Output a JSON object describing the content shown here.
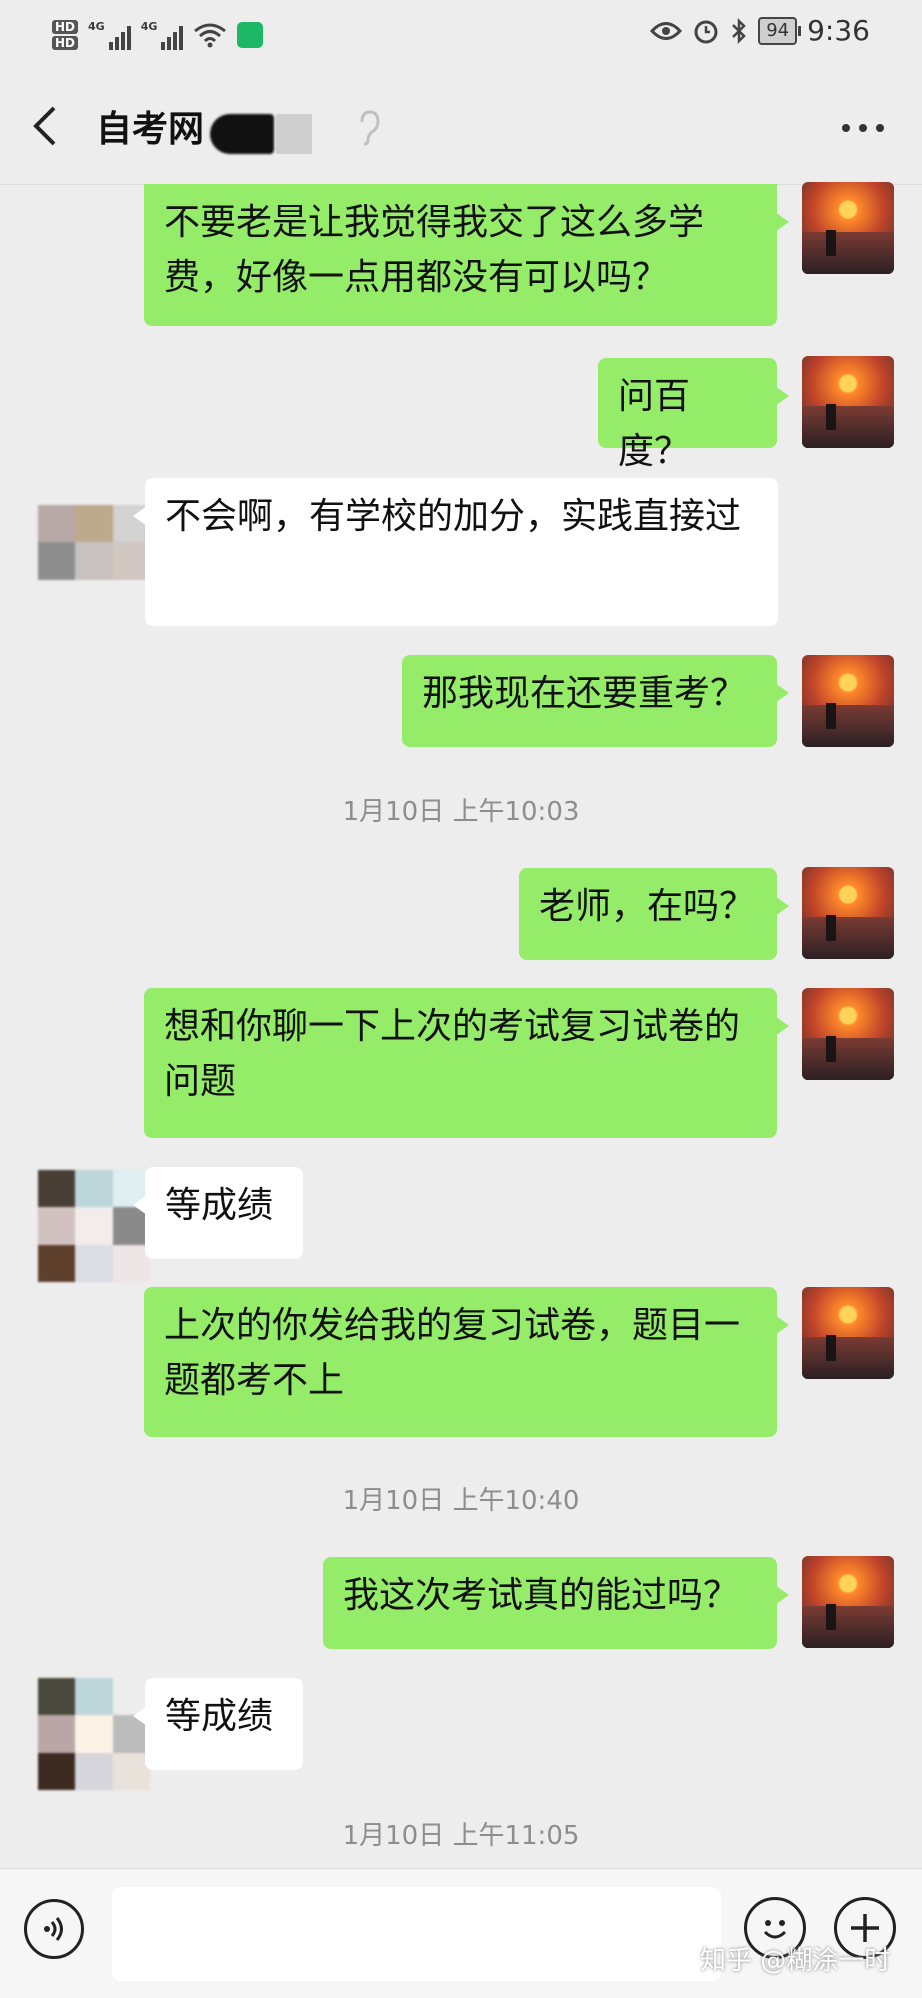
{
  "status_bar": {
    "hd1": "HD",
    "hd2": "HD",
    "net1": "4G",
    "net2": "4G",
    "battery": "94",
    "time": "9:36"
  },
  "header": {
    "title": "自考网",
    "back_icon": "chevron-left-icon",
    "more_icon": "more-icon"
  },
  "messages": [
    {
      "from": "me",
      "text": "不要老是让我觉得我交了这么多学费，好像一点用都没有可以吗？"
    },
    {
      "from": "me",
      "text": "问百度？"
    },
    {
      "from": "other",
      "text": "不会啊，有学校的加分，实践直接过"
    },
    {
      "from": "me",
      "text": "那我现在还要重考？"
    },
    {
      "type": "time",
      "text": "1月10日 上午10:03"
    },
    {
      "from": "me",
      "text": "老师，在吗？"
    },
    {
      "from": "me",
      "text": "想和你聊一下上次的考试复习试卷的问题"
    },
    {
      "from": "other",
      "text": "等成绩"
    },
    {
      "from": "me",
      "text": "上次的你发给我的复习试卷，题目一题都考不上"
    },
    {
      "type": "time",
      "text": "1月10日 上午10:40"
    },
    {
      "from": "me",
      "text": "我这次考试真的能过吗？"
    },
    {
      "from": "other",
      "text": "等成绩"
    },
    {
      "type": "time",
      "text": "1月10日 上午11:05"
    }
  ],
  "input_bar": {
    "voice_icon": "voice-icon",
    "emoji_icon": "emoji-icon",
    "plus_icon": "plus-icon",
    "text_value": ""
  },
  "watermark": "知乎 @糊涂一时",
  "colors": {
    "background": "#ededed",
    "my_bubble": "#95ec69",
    "other_bubble": "#ffffff",
    "timestamp": "#8d8d8d"
  }
}
